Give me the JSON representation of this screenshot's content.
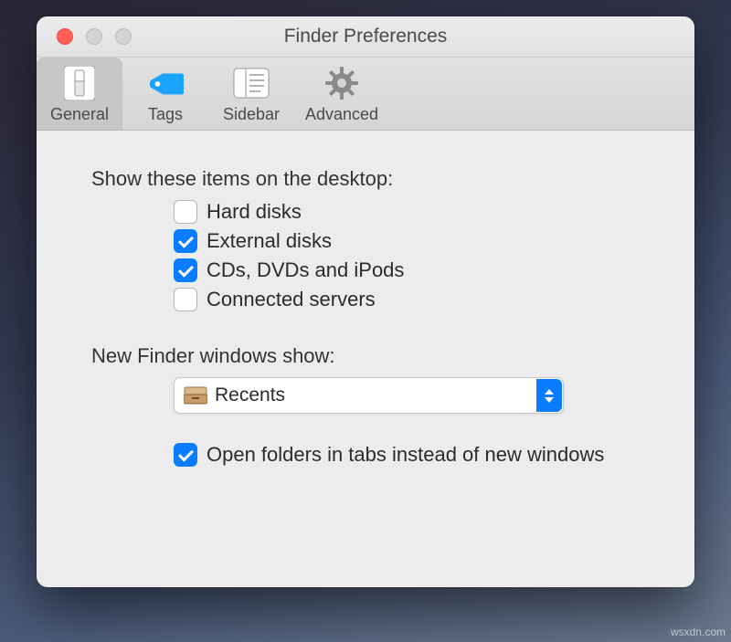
{
  "window": {
    "title": "Finder Preferences"
  },
  "tabs": {
    "general": "General",
    "tags": "Tags",
    "sidebar": "Sidebar",
    "advanced": "Advanced"
  },
  "sections": {
    "desktop_items_label": "Show these items on the desktop:",
    "new_window_label": "New Finder windows show:"
  },
  "checkboxes": {
    "hard_disks": {
      "label": "Hard disks",
      "checked": false
    },
    "external_disks": {
      "label": "External disks",
      "checked": true
    },
    "cds_dvds_ipods": {
      "label": "CDs, DVDs and iPods",
      "checked": true
    },
    "connected_servers": {
      "label": "Connected servers",
      "checked": false
    },
    "open_in_tabs": {
      "label": "Open folders in tabs instead of new windows",
      "checked": true
    }
  },
  "select": {
    "value": "Recents"
  },
  "watermark": "wsxdn.com"
}
